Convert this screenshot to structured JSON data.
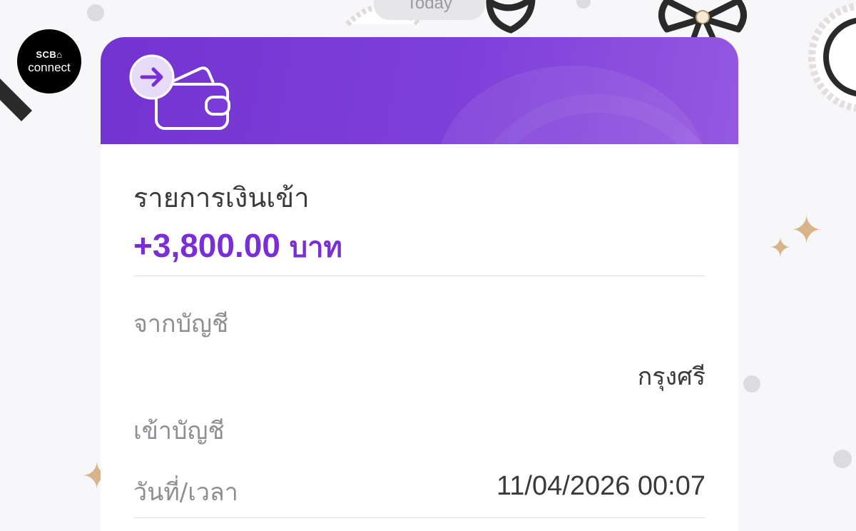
{
  "chat": {
    "date_pill": "Today",
    "sender_avatar": {
      "line1": "SCB⌂",
      "line2": "connect"
    }
  },
  "notification_card": {
    "icon": "wallet-arrow-in-icon",
    "header_color": "#7433d1",
    "title": "รายการเงินเข้า",
    "amount": "+3,800.00",
    "currency": "บาท",
    "accent_color": "#7a2fd6",
    "rows": [
      {
        "label": "จากบัญชี",
        "value": "กรุงศรี"
      },
      {
        "label": "เข้าบัญชี",
        "value": ""
      },
      {
        "label": "วันที่/เวลา",
        "value": "11/04/2026 00:07"
      }
    ]
  }
}
